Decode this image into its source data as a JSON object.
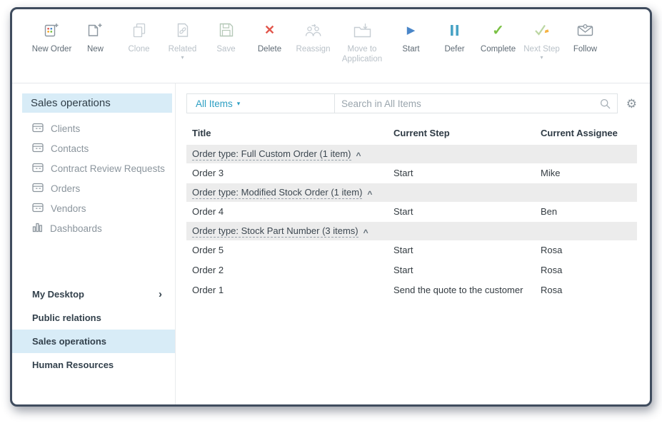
{
  "colors": {
    "frame": "#3f4c5e",
    "accent": "#2d9fc3",
    "selection": "#d8ecf7",
    "danger": "#e2574c",
    "success": "#7ac143",
    "info": "#4a86c8",
    "pause": "#49a3c5",
    "warning": "#f5a623"
  },
  "toolbar": {
    "buttons": [
      {
        "label": "New Order",
        "icon": "new-order",
        "enabled": true,
        "has_menu": false
      },
      {
        "label": "New",
        "icon": "new-document",
        "enabled": true,
        "has_menu": false
      },
      {
        "label": "Clone",
        "icon": "clone",
        "enabled": false,
        "has_menu": false
      },
      {
        "label": "Related",
        "icon": "related",
        "enabled": false,
        "has_menu": true
      },
      {
        "label": "Save",
        "icon": "save",
        "enabled": false,
        "has_menu": false
      },
      {
        "label": "Delete",
        "icon": "delete",
        "enabled": true,
        "has_menu": false
      },
      {
        "label": "Reassign",
        "icon": "reassign",
        "enabled": false,
        "has_menu": false
      },
      {
        "label": "Move to Application",
        "icon": "move-to-application",
        "enabled": false,
        "has_menu": false
      },
      {
        "label": "Start",
        "icon": "start",
        "enabled": true,
        "has_menu": false
      },
      {
        "label": "Defer",
        "icon": "defer",
        "enabled": true,
        "has_menu": false
      },
      {
        "label": "Complete",
        "icon": "complete",
        "enabled": true,
        "has_menu": false
      },
      {
        "label": "Next Step",
        "icon": "next-step",
        "enabled": false,
        "has_menu": true
      },
      {
        "label": "Follow",
        "icon": "follow",
        "enabled": true,
        "has_menu": false
      }
    ]
  },
  "sidebar": {
    "title": "Sales operations",
    "items": [
      {
        "label": "Clients",
        "icon": "table"
      },
      {
        "label": "Contacts",
        "icon": "table"
      },
      {
        "label": "Contract Review Requests",
        "icon": "table"
      },
      {
        "label": "Orders",
        "icon": "table"
      },
      {
        "label": "Vendors",
        "icon": "table"
      },
      {
        "label": "Dashboards",
        "icon": "bar-chart"
      }
    ],
    "workspaces": [
      {
        "label": "My Desktop",
        "has_submenu": true,
        "selected": false
      },
      {
        "label": "Public relations",
        "has_submenu": false,
        "selected": false
      },
      {
        "label": "Sales operations",
        "has_submenu": false,
        "selected": true
      },
      {
        "label": "Human Resources",
        "has_submenu": false,
        "selected": false
      }
    ]
  },
  "filter_bar": {
    "view_selector": "All Items",
    "search_placeholder": "Search in All Items"
  },
  "table": {
    "columns": [
      "Title",
      "Current Step",
      "Current Assignee"
    ],
    "groups": [
      {
        "label": "Order type: Full Custom Order (1 item)",
        "rows": [
          {
            "title": "Order 3",
            "current_step": "Start",
            "current_assignee": "Mike"
          }
        ]
      },
      {
        "label": "Order type: Modified Stock Order (1 item)",
        "rows": [
          {
            "title": "Order 4",
            "current_step": "Start",
            "current_assignee": "Ben"
          }
        ]
      },
      {
        "label": "Order type: Stock Part Number (3 items)",
        "rows": [
          {
            "title": "Order 5",
            "current_step": "Start",
            "current_assignee": "Rosa"
          },
          {
            "title": "Order 2",
            "current_step": "Start",
            "current_assignee": "Rosa"
          },
          {
            "title": "Order 1",
            "current_step": "Send the quote to the customer",
            "current_assignee": "Rosa"
          }
        ]
      }
    ]
  }
}
